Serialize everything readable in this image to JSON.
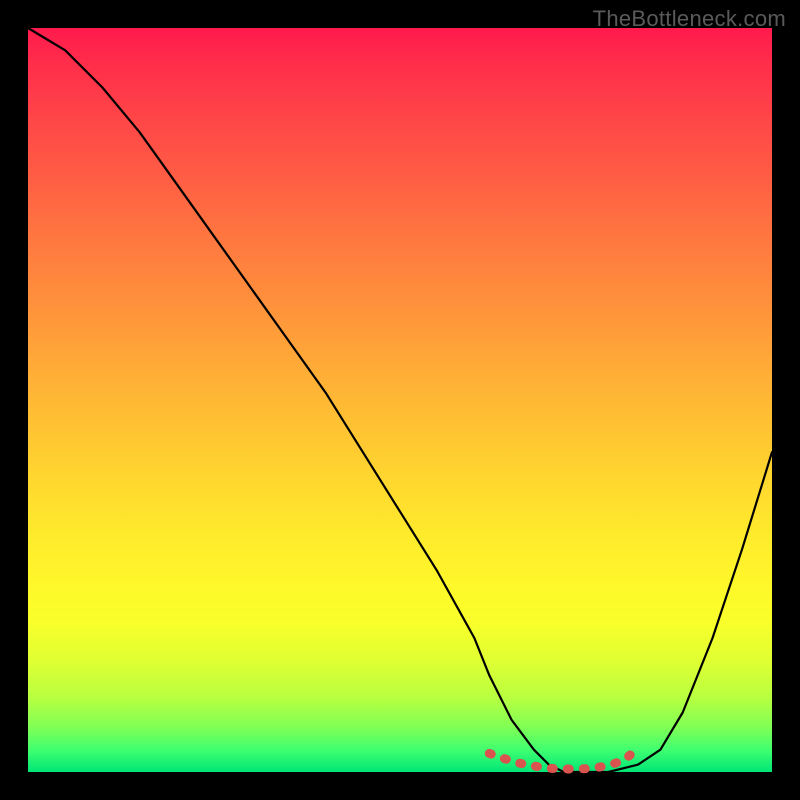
{
  "watermark": "TheBottleneck.com",
  "chart_data": {
    "type": "line",
    "title": "",
    "xlabel": "",
    "ylabel": "",
    "xlim": [
      0,
      100
    ],
    "ylim": [
      0,
      100
    ],
    "series": [
      {
        "name": "bottleneck-curve",
        "x": [
          0,
          5,
          10,
          15,
          20,
          25,
          30,
          35,
          40,
          45,
          50,
          55,
          60,
          62,
          65,
          68,
          70,
          72,
          75,
          78,
          80,
          82,
          85,
          88,
          92,
          96,
          100
        ],
        "values": [
          100,
          97,
          92,
          86,
          79,
          72,
          65,
          58,
          51,
          43,
          35,
          27,
          18,
          13,
          7,
          3,
          1,
          0,
          0,
          0,
          0.5,
          1,
          3,
          8,
          18,
          30,
          43
        ]
      }
    ],
    "highlight_segment": {
      "name": "optimal-range",
      "x": [
        62,
        64,
        66,
        68,
        70,
        72,
        74,
        76,
        78,
        80,
        82
      ],
      "values": [
        2.5,
        1.8,
        1.2,
        0.8,
        0.5,
        0.4,
        0.4,
        0.5,
        0.9,
        1.5,
        3.2
      ]
    },
    "highlight_style": "dashed-red",
    "gradient": [
      "#ff1a4d",
      "#ffea2c",
      "#00e676"
    ]
  }
}
